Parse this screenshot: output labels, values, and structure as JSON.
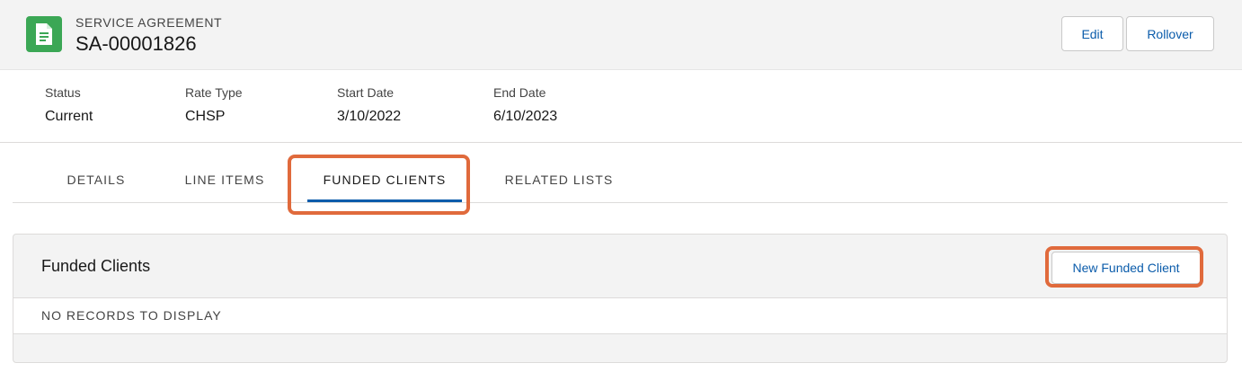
{
  "header": {
    "object_label": "SERVICE AGREEMENT",
    "record_name": "SA-00001826",
    "icon": "document-icon",
    "icon_color": "#3ba755",
    "buttons": {
      "edit": "Edit",
      "rollover": "Rollover"
    }
  },
  "highlights": [
    {
      "label": "Status",
      "value": "Current"
    },
    {
      "label": "Rate Type",
      "value": "CHSP"
    },
    {
      "label": "Start Date",
      "value": "3/10/2022"
    },
    {
      "label": "End Date",
      "value": "6/10/2023"
    }
  ],
  "tabs": [
    {
      "label": "DETAILS"
    },
    {
      "label": "LINE ITEMS"
    },
    {
      "label": "FUNDED CLIENTS",
      "active": true
    },
    {
      "label": "RELATED LISTS"
    }
  ],
  "related_list": {
    "title": "Funded Clients",
    "new_button": "New Funded Client",
    "empty_text": "NO RECORDS TO DISPLAY"
  },
  "colors": {
    "accent": "#0b5cab",
    "annotation": "#e06a3c"
  }
}
